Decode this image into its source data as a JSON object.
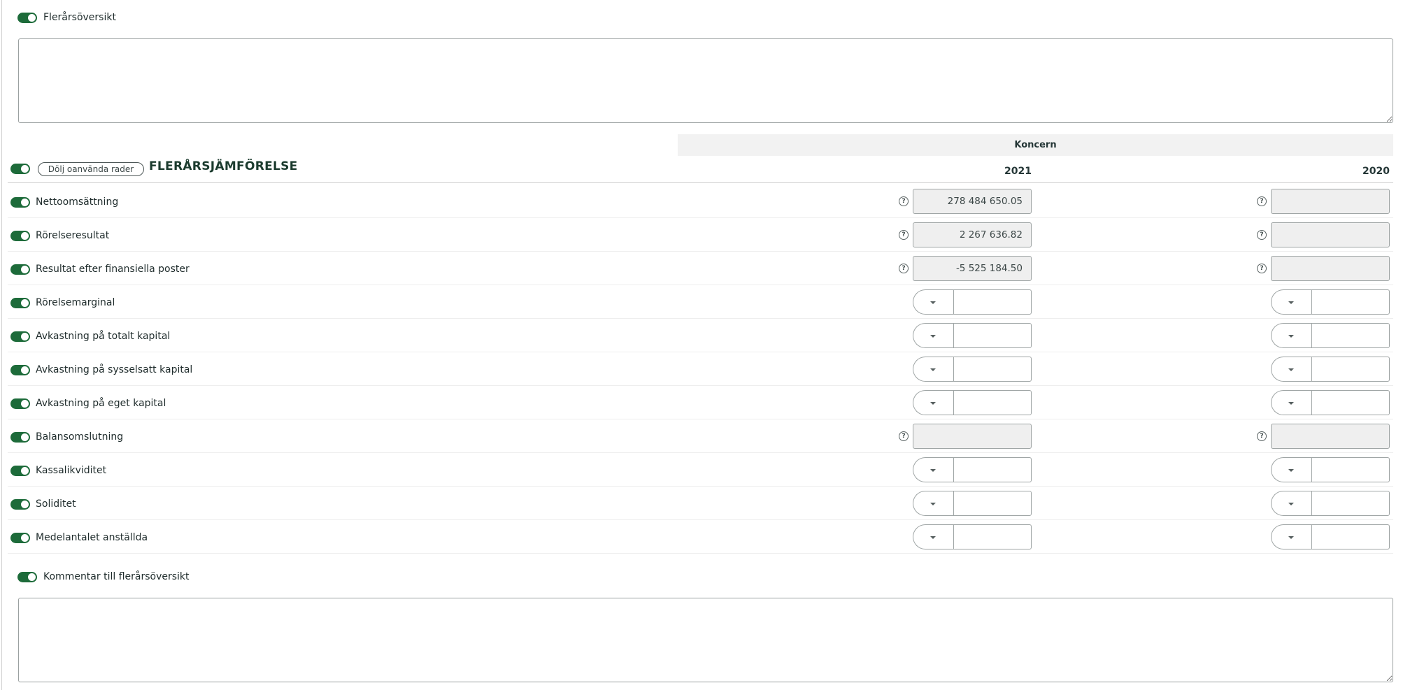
{
  "top_section": {
    "toggle_label": "Flerårsöversikt",
    "textarea_value": ""
  },
  "comparison": {
    "group_header": "Koncern",
    "years": [
      "2021",
      "2020"
    ],
    "hide_unused_label": "Dölj oanvända rader",
    "title": "FLERÅRSJÄMFÖRELSE",
    "rows": [
      {
        "label": "Nettoomsättning",
        "type": "readonly",
        "values": [
          "278 484 650.05",
          ""
        ]
      },
      {
        "label": "Rörelseresultat",
        "type": "readonly",
        "values": [
          "2 267 636.82",
          ""
        ]
      },
      {
        "label": "Resultat efter finansiella poster",
        "type": "readonly",
        "values": [
          "-5 525 184.50",
          ""
        ]
      },
      {
        "label": "Rörelsemarginal",
        "type": "select",
        "values": [
          "",
          ""
        ]
      },
      {
        "label": "Avkastning på totalt kapital",
        "type": "select",
        "values": [
          "",
          ""
        ]
      },
      {
        "label": "Avkastning på sysselsatt kapital",
        "type": "select",
        "values": [
          "",
          ""
        ]
      },
      {
        "label": "Avkastning på eget kapital",
        "type": "select",
        "values": [
          "",
          ""
        ]
      },
      {
        "label": "Balansomslutning",
        "type": "readonly",
        "values": [
          "",
          ""
        ]
      },
      {
        "label": "Kassalikviditet",
        "type": "select",
        "values": [
          "",
          ""
        ]
      },
      {
        "label": "Soliditet",
        "type": "select",
        "values": [
          "",
          ""
        ]
      },
      {
        "label": "Medelantalet anställda",
        "type": "select",
        "values": [
          "",
          ""
        ]
      }
    ]
  },
  "comment_section": {
    "toggle_label": "Kommentar till flerårsöversikt",
    "textarea_value": ""
  },
  "icons": {
    "help": "?"
  },
  "colors": {
    "toggle_on": "#1d6b3a",
    "readonly_bg": "#efefef",
    "title": "#1b3b2e"
  }
}
